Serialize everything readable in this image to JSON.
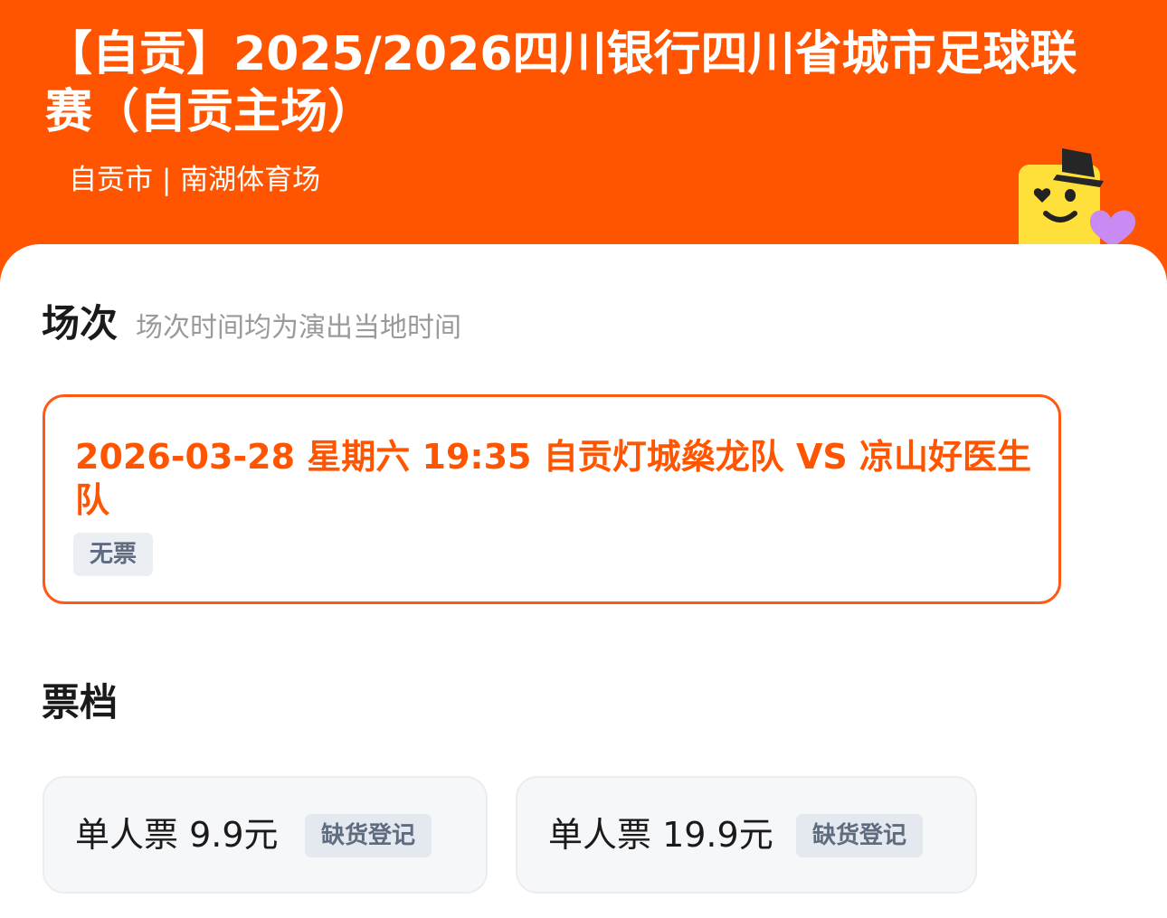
{
  "event": {
    "title": "【自贡】2025/2026四川银行四川省城市足球联赛（自贡主场）",
    "venue": "自贡市 | 南湖体育场"
  },
  "sessions": {
    "title": "场次",
    "note": "场次时间均为演出当地时间",
    "selected": {
      "text": "2026-03-28 星期六 19:35 自贡灯城燊龙队 VS 凉山好医生队",
      "status": "无票"
    }
  },
  "tickets": {
    "title": "票档",
    "items": [
      {
        "label": "单人票 9.9元",
        "action": "缺货登记"
      },
      {
        "label": "单人票 19.9元",
        "action": "缺货登记"
      }
    ]
  },
  "colors": {
    "brand_orange": "#ff5500",
    "selected_border": "#ff5a14",
    "status_gray": "#5f6b7f",
    "card_bg": "#f6f7f9"
  },
  "icons": {
    "mascot": "smiling-yellow-mascot-with-hat-and-heart"
  }
}
